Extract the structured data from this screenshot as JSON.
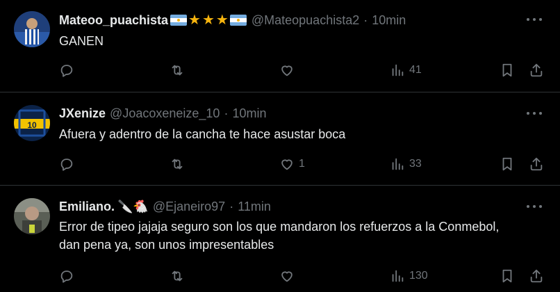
{
  "tweets": [
    {
      "name": "Mateoo_puachista",
      "handle": "@Mateopuachista2",
      "separator": "·",
      "time": "10min",
      "text": "GANEN",
      "badges": [
        "argentina-flag",
        "star",
        "star",
        "star",
        "argentina-flag"
      ],
      "replies": "",
      "reposts": "",
      "likes": "",
      "views": "41"
    },
    {
      "name": "JXenize",
      "handle": "@Joacoxeneize_10",
      "separator": "·",
      "time": "10min",
      "text": "Afuera y adentro de la cancha te hace asustar boca",
      "badges": [],
      "replies": "",
      "reposts": "",
      "likes": "1",
      "views": "33"
    },
    {
      "name": "Emiliano.",
      "handle": "@Ejaneiro97",
      "separator": "·",
      "time": "11min",
      "text": "Error de tipeo jajaja seguro son los que mandaron los refuerzos a la Conmebol, dan pena ya, son unos impresentables",
      "badges": [
        "knife-emoji",
        "chicken-emoji"
      ],
      "emoji_text": "🔪🐔",
      "replies": "",
      "reposts": "",
      "likes": "",
      "views": "130"
    }
  ],
  "colors": {
    "background": "#000000",
    "text": "#e7e9ea",
    "muted": "#71767b",
    "divider": "#2f3336",
    "star": "#f6b40e",
    "flag_blue": "#74acdf"
  }
}
